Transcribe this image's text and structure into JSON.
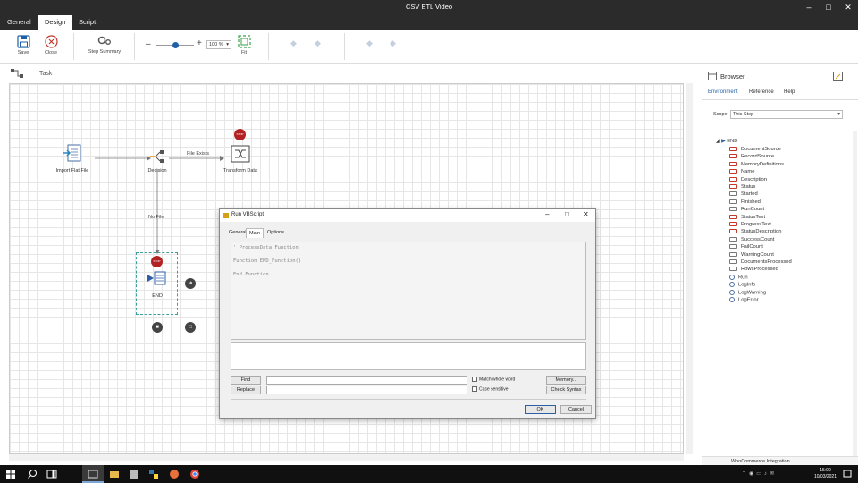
{
  "window": {
    "title": "CSV ETL Video"
  },
  "ribbon": {
    "tabs": [
      "General",
      "Design",
      "Script"
    ],
    "active_tab": "Design",
    "save_label": "Save",
    "close_label": "Close",
    "step_summary_label": "Step Summary",
    "zoom_value": "100 %",
    "fit_label": "Fit",
    "zoom_fraction": 0.5
  },
  "task": {
    "label": "Task"
  },
  "flow": {
    "nodes": {
      "import": "Import Flat File",
      "decision": "Decision",
      "transform": "Transform Data",
      "end": "END"
    },
    "edges": {
      "file_exists": "File Exists",
      "no_file": "No File"
    },
    "stop_badge": "STOP"
  },
  "browser": {
    "title": "Browser",
    "tabs": [
      "Environment",
      "Reference",
      "Help"
    ],
    "active_tab": "Environment",
    "scope_label": "Scope",
    "scope_value": "This Step",
    "tree_root": "END",
    "items": [
      {
        "label": "DocumentSource",
        "kind": "prop"
      },
      {
        "label": "RecordSource",
        "kind": "prop"
      },
      {
        "label": "MemoryDefinitions",
        "kind": "prop"
      },
      {
        "label": "Name",
        "kind": "prop"
      },
      {
        "label": "Description",
        "kind": "prop"
      },
      {
        "label": "Status",
        "kind": "prop"
      },
      {
        "label": "Started",
        "kind": "plain"
      },
      {
        "label": "Finished",
        "kind": "plain"
      },
      {
        "label": "RunCount",
        "kind": "plain"
      },
      {
        "label": "StatusText",
        "kind": "prop"
      },
      {
        "label": "ProgressText",
        "kind": "prop"
      },
      {
        "label": "StatusDescription",
        "kind": "prop"
      },
      {
        "label": "SuccessCount",
        "kind": "plain"
      },
      {
        "label": "FailCount",
        "kind": "plain"
      },
      {
        "label": "WarningCount",
        "kind": "plain"
      },
      {
        "label": "DocumentsProcessed",
        "kind": "plain"
      },
      {
        "label": "RowsProcessed",
        "kind": "plain"
      },
      {
        "label": "Run",
        "kind": "method"
      },
      {
        "label": "LogInfo",
        "kind": "method"
      },
      {
        "label": "LogWarning",
        "kind": "method"
      },
      {
        "label": "LogError",
        "kind": "method"
      }
    ],
    "footer": "WooCommerce Integration"
  },
  "dialog": {
    "title": "Run VBScript",
    "tabs": [
      "General",
      "Main",
      "Options"
    ],
    "active_tab": "Main",
    "code_lines": [
      "' ProcessData Function",
      "",
      "Function END_Function()",
      "",
      "End Function"
    ],
    "find_label": "Find",
    "replace_label": "Replace",
    "match_whole_word": "Match whole word",
    "case_sensitive": "Case sensitive",
    "memory_label": "Memory...",
    "check_syntax_label": "Check Syntax",
    "ok_label": "OK",
    "cancel_label": "Cancel"
  },
  "taskbar": {
    "time": "15:00",
    "date": "10/03/2021"
  },
  "colors": {
    "accent": "#1f5fa5",
    "titlebar": "#2b2b2b",
    "stop": "#b22222",
    "taskbar": "#101010"
  }
}
